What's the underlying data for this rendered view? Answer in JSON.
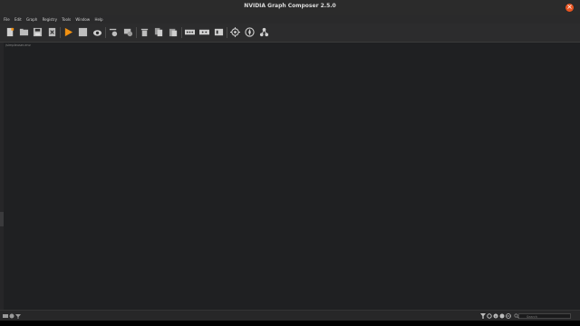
{
  "window": {
    "title": "NVIDIA Graph Composer 2.5.0"
  },
  "menu": {
    "items": [
      "File",
      "Edit",
      "Graph",
      "Registry",
      "Tools",
      "Window",
      "Help"
    ]
  },
  "toolbar": {
    "buttons": [
      {
        "name": "new-graph",
        "icon": "new-file-icon"
      },
      {
        "name": "open-graph",
        "icon": "open-folder-icon"
      },
      {
        "name": "save-graph",
        "icon": "save-icon"
      },
      {
        "name": "close-graph",
        "icon": "close-file-icon"
      },
      {
        "name": "run-graph",
        "icon": "play-icon"
      },
      {
        "name": "stop-graph",
        "icon": "stop-icon"
      },
      {
        "name": "deploy",
        "icon": "deploy-icon"
      },
      {
        "name": "add-component",
        "icon": "add-component-icon"
      },
      {
        "name": "edit-component",
        "icon": "component-gear-icon"
      },
      {
        "name": "delete",
        "icon": "trash-icon"
      },
      {
        "name": "copy",
        "icon": "copy-icon"
      },
      {
        "name": "paste",
        "icon": "paste-icon"
      },
      {
        "name": "more",
        "icon": "more-icon"
      },
      {
        "name": "connect",
        "icon": "connect-icon"
      },
      {
        "name": "terminal",
        "icon": "terminal-icon"
      },
      {
        "name": "fit-view",
        "icon": "target-icon"
      },
      {
        "name": "center-view",
        "icon": "compass-icon"
      },
      {
        "name": "layout",
        "icon": "tree-layout-icon"
      }
    ]
  },
  "canvas": {
    "breadcrumb": "/simpleuser-env"
  },
  "statusbar": {
    "search_placeholder": "Search"
  },
  "colors": {
    "accent_orange": "#f29111",
    "close_button": "#e95420",
    "background": "#1f2022"
  }
}
